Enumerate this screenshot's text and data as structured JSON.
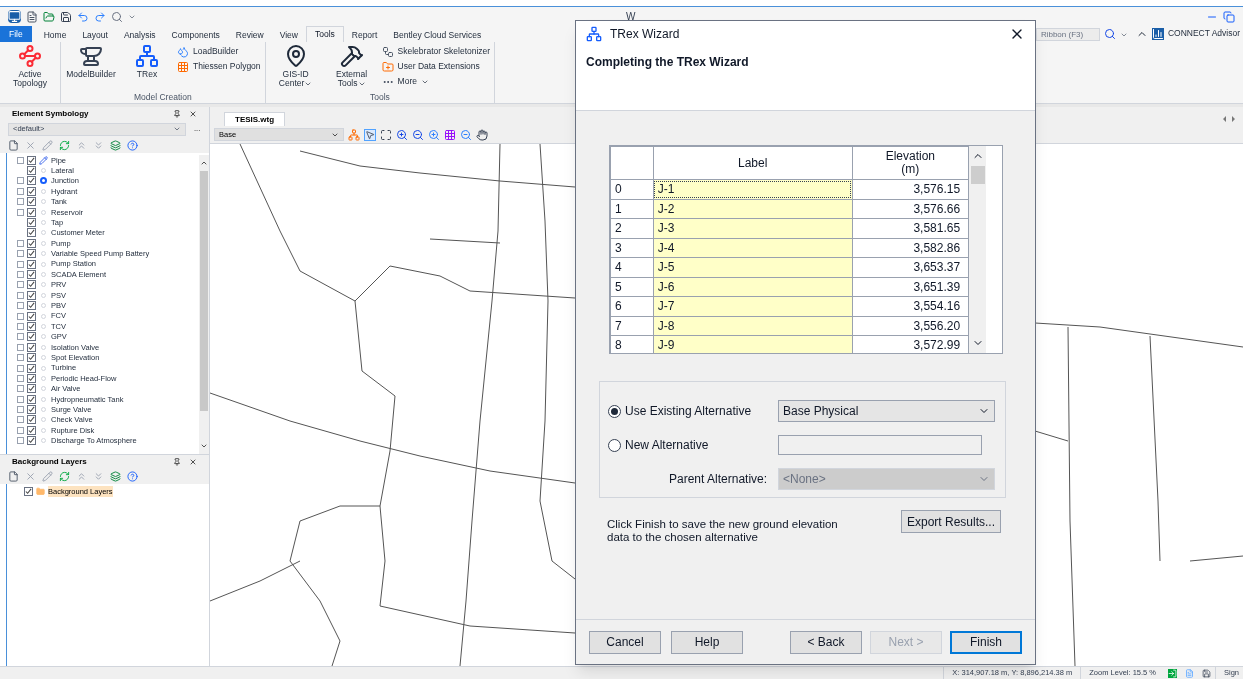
{
  "window": {
    "title": "W"
  },
  "ribbon_tabs": [
    {
      "label": "File",
      "kind": "file",
      "selected": false
    },
    {
      "label": "Home",
      "kind": "tab",
      "selected": false
    },
    {
      "label": "Layout",
      "kind": "tab",
      "selected": false
    },
    {
      "label": "Analysis",
      "kind": "tab",
      "selected": false
    },
    {
      "label": "Components",
      "kind": "tab",
      "selected": false
    },
    {
      "label": "Review",
      "kind": "tab",
      "selected": false
    },
    {
      "label": "View",
      "kind": "tab",
      "selected": false
    },
    {
      "label": "Tools",
      "kind": "tab",
      "selected": true
    },
    {
      "label": "Report",
      "kind": "tab",
      "selected": false
    },
    {
      "label": "Bentley Cloud Services",
      "kind": "tab",
      "selected": false
    }
  ],
  "ribbon_search": {
    "placeholder": "Ribbon (F3)"
  },
  "connect_advisor": "CONNECT Advisor",
  "ribbon_groups": [
    {
      "items": [
        {
          "label": "Active Topology",
          "kind": "large",
          "dropdown": false
        }
      ]
    },
    {
      "title": "Model Creation",
      "items": [
        {
          "label": "ModelBuilder",
          "kind": "large",
          "dropdown": false
        },
        {
          "label": "TRex",
          "kind": "large",
          "dropdown": false
        },
        {
          "label": "LoadBuilder",
          "kind": "small",
          "dropdown": false
        },
        {
          "label": "Thiessen Polygon",
          "kind": "small",
          "dropdown": false
        }
      ]
    },
    {
      "title": "Tools",
      "items": [
        {
          "label": "GIS-ID Center",
          "kind": "large",
          "dropdown": true
        },
        {
          "label": "External Tools",
          "kind": "large",
          "dropdown": true
        },
        {
          "label": "Skelebrator Skeletonizer",
          "kind": "small",
          "dropdown": false
        },
        {
          "label": "User Data Extensions",
          "kind": "small",
          "dropdown": false
        },
        {
          "label": "More",
          "kind": "small",
          "dropdown": true
        }
      ]
    }
  ],
  "element_symbology": {
    "title": "Element Symbology",
    "dropdown_value": "<default>",
    "more_button": "...",
    "items": [
      {
        "label": "Pipe",
        "kind": "pipe",
        "expandable": true,
        "checked": true
      },
      {
        "label": "Lateral",
        "kind": "element",
        "expandable": false,
        "checked": true
      },
      {
        "label": "Junction",
        "kind": "junction",
        "expandable": true,
        "checked": true
      },
      {
        "label": "Hydrant",
        "kind": "element",
        "expandable": true,
        "checked": true
      },
      {
        "label": "Tank",
        "kind": "element",
        "expandable": true,
        "checked": true
      },
      {
        "label": "Reservoir",
        "kind": "element",
        "expandable": true,
        "checked": true
      },
      {
        "label": "Tap",
        "kind": "element",
        "expandable": false,
        "checked": true
      },
      {
        "label": "Customer Meter",
        "kind": "element",
        "expandable": false,
        "checked": true
      },
      {
        "label": "Pump",
        "kind": "element",
        "expandable": true,
        "checked": true
      },
      {
        "label": "Variable Speed Pump Battery",
        "kind": "element",
        "expandable": true,
        "checked": true
      },
      {
        "label": "Pump Station",
        "kind": "element",
        "expandable": true,
        "checked": true
      },
      {
        "label": "SCADA Element",
        "kind": "element",
        "expandable": true,
        "checked": true
      },
      {
        "label": "PRV",
        "kind": "element",
        "expandable": true,
        "checked": true
      },
      {
        "label": "PSV",
        "kind": "element",
        "expandable": true,
        "checked": true
      },
      {
        "label": "PBV",
        "kind": "element",
        "expandable": true,
        "checked": true
      },
      {
        "label": "FCV",
        "kind": "element",
        "expandable": true,
        "checked": true
      },
      {
        "label": "TCV",
        "kind": "element",
        "expandable": true,
        "checked": true
      },
      {
        "label": "GPV",
        "kind": "element",
        "expandable": true,
        "checked": true
      },
      {
        "label": "Isolation Valve",
        "kind": "element",
        "expandable": true,
        "checked": true
      },
      {
        "label": "Spot Elevation",
        "kind": "element",
        "expandable": true,
        "checked": true
      },
      {
        "label": "Turbine",
        "kind": "element",
        "expandable": true,
        "checked": true
      },
      {
        "label": "Periodic Head-Flow",
        "kind": "element",
        "expandable": true,
        "checked": true
      },
      {
        "label": "Air Valve",
        "kind": "element",
        "expandable": true,
        "checked": true
      },
      {
        "label": "Hydropneumatic Tank",
        "kind": "element",
        "expandable": true,
        "checked": true
      },
      {
        "label": "Surge Valve",
        "kind": "element",
        "expandable": true,
        "checked": true
      },
      {
        "label": "Check Valve",
        "kind": "element",
        "expandable": true,
        "checked": true
      },
      {
        "label": "Rupture Disk",
        "kind": "element",
        "expandable": true,
        "checked": true
      },
      {
        "label": "Discharge To Atmosphere",
        "kind": "element",
        "expandable": true,
        "checked": true
      }
    ]
  },
  "background_layers": {
    "title": "Background Layers",
    "items": [
      {
        "label": "Background Layers",
        "checked": true
      }
    ]
  },
  "document_tab": {
    "label": "TESIS.wtg"
  },
  "scenario_dropdown": {
    "value": "Base"
  },
  "status_bar": {
    "coordinates": "X: 314,907.18 m, Y: 8,896,214.38 m",
    "zoom": "Zoom Level: 15.5 %",
    "sign": "Sign"
  },
  "dialog": {
    "title": "TRex Wizard",
    "heading": "Completing the TRex Wizard",
    "table": {
      "columns": [
        "Label",
        "Elevation\n(m)"
      ],
      "rows": [
        {
          "index": "0",
          "label": "J-1",
          "elevation": "3,576.15",
          "focused": true
        },
        {
          "index": "1",
          "label": "J-2",
          "elevation": "3,576.66",
          "focused": false
        },
        {
          "index": "2",
          "label": "J-3",
          "elevation": "3,581.65",
          "focused": false
        },
        {
          "index": "3",
          "label": "J-4",
          "elevation": "3,582.86",
          "focused": false
        },
        {
          "index": "4",
          "label": "J-5",
          "elevation": "3,653.37",
          "focused": false
        },
        {
          "index": "5",
          "label": "J-6",
          "elevation": "3,651.39",
          "focused": false
        },
        {
          "index": "6",
          "label": "J-7",
          "elevation": "3,554.16",
          "focused": false
        },
        {
          "index": "7",
          "label": "J-8",
          "elevation": "3,556.20",
          "focused": false
        },
        {
          "index": "8",
          "label": "J-9",
          "elevation": "3,572.99",
          "focused": false
        }
      ]
    },
    "options": [
      {
        "label": "Use Existing Alternative",
        "selected": true,
        "kind": "select",
        "value": "Base Physical"
      },
      {
        "label": "New Alternative",
        "selected": false,
        "kind": "input"
      }
    ],
    "parent_alternative": {
      "label": "Parent Alternative:",
      "value": "<None>",
      "disabled": true
    },
    "note": "Click Finish to save the new ground elevation data to the chosen alternative",
    "export_button": "Export Results...",
    "buttons": [
      {
        "label": "Cancel",
        "disabled": false,
        "default": false
      },
      {
        "label": "Help",
        "disabled": false,
        "default": false
      },
      {
        "label": "< Back",
        "disabled": false,
        "default": false
      },
      {
        "label": "Next >",
        "disabled": true,
        "default": false
      },
      {
        "label": "Finish",
        "disabled": false,
        "default": true
      }
    ]
  }
}
